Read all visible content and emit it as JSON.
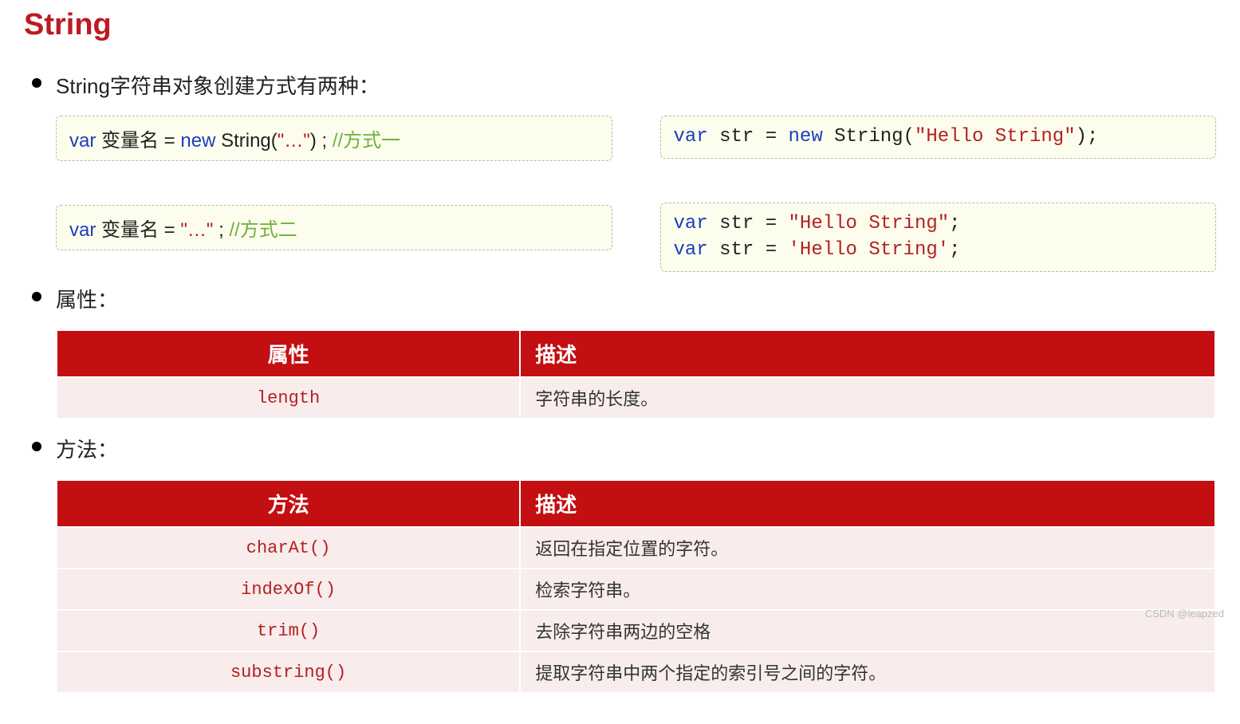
{
  "heading": "String",
  "intro": "String字符串对象创建方式有两种：",
  "code": {
    "left1": {
      "tokens": [
        {
          "t": "var ",
          "c": "kw"
        },
        {
          "t": "变量名 = ",
          "c": "cls"
        },
        {
          "t": "new ",
          "c": "kw"
        },
        {
          "t": "String(",
          "c": "cls"
        },
        {
          "t": "\"…\"",
          "c": "str"
        },
        {
          "t": ") ; ",
          "c": "cls"
        },
        {
          "t": "//方式一",
          "c": "cmt"
        }
      ]
    },
    "left2": {
      "tokens": [
        {
          "t": "var ",
          "c": "kw"
        },
        {
          "t": "变量名 = ",
          "c": "cls"
        },
        {
          "t": "\"…\"",
          "c": "str"
        },
        {
          "t": " ; ",
          "c": "cls"
        },
        {
          "t": "//方式二",
          "c": "cmt"
        }
      ]
    },
    "right1": {
      "tokens": [
        {
          "t": "var ",
          "c": "kw"
        },
        {
          "t": "str = ",
          "c": "cls"
        },
        {
          "t": "new ",
          "c": "kw"
        },
        {
          "t": "String(",
          "c": "cls"
        },
        {
          "t": "\"Hello String\"",
          "c": "str"
        },
        {
          "t": ");",
          "c": "cls"
        }
      ]
    },
    "right2": {
      "lines": [
        [
          {
            "t": "var ",
            "c": "kw"
          },
          {
            "t": "str = ",
            "c": "cls"
          },
          {
            "t": "\"Hello String\"",
            "c": "str"
          },
          {
            "t": ";",
            "c": "cls"
          }
        ],
        [
          {
            "t": "var ",
            "c": "kw"
          },
          {
            "t": "str = ",
            "c": "cls"
          },
          {
            "t": "'Hello String'",
            "c": "str"
          },
          {
            "t": ";",
            "c": "cls"
          }
        ]
      ]
    }
  },
  "props_label": "属性：",
  "methods_label": "方法：",
  "props_table": {
    "headers": [
      "属性",
      "描述"
    ],
    "rows": [
      [
        "length",
        "字符串的长度。"
      ]
    ]
  },
  "methods_table": {
    "headers": [
      "方法",
      "描述"
    ],
    "rows": [
      [
        "charAt()",
        "返回在指定位置的字符。"
      ],
      [
        "indexOf()",
        "检索字符串。"
      ],
      [
        "trim()",
        "去除字符串两边的空格"
      ],
      [
        "substring()",
        "提取字符串中两个指定的索引号之间的字符。"
      ]
    ]
  },
  "watermark": "CSDN @leapzed"
}
